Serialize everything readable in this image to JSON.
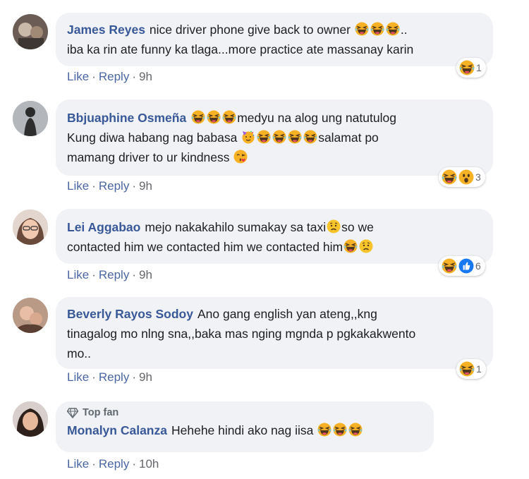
{
  "comments": [
    {
      "author": "James Reyes",
      "text_a": "nice driver phone give back to owner ",
      "text_b": "..",
      "text_c": "iba ka rin ate funny ka tlaga...more practice ate massanay karin",
      "actions": {
        "like": "Like",
        "reply": "Reply",
        "time": "9h"
      },
      "reaction_count": "1"
    },
    {
      "author": "Bbjuaphine Osmeña",
      "text_a": "medyu na alog ung natutulog",
      "text_b": "Kung diwa habang nag babasa ",
      "text_c": "salamat po",
      "text_d": "mamang driver to ur kindness ",
      "actions": {
        "like": "Like",
        "reply": "Reply",
        "time": "9h"
      },
      "reaction_count": "3"
    },
    {
      "author": "Lei Aggabao",
      "text_a": "mejo nakakahilo sumakay sa taxi",
      "text_b": "so we",
      "text_c": "contacted him we contacted him we contacted him",
      "actions": {
        "like": "Like",
        "reply": "Reply",
        "time": "9h"
      },
      "reaction_count": "6"
    },
    {
      "author": "Beverly Rayos Sodoy",
      "text_a": "Ano gang english yan ateng,,kng",
      "text_b": "tinagalog mo nlng sna,,baka mas nging mgnda p pgkakakwento",
      "text_c": "mo..",
      "actions": {
        "like": "Like",
        "reply": "Reply",
        "time": "9h"
      },
      "reaction_count": "1"
    },
    {
      "badge": "Top fan",
      "author": "Monalyn Calanza",
      "text_a": "Hehehe hindi ako nag iisa ",
      "actions": {
        "like": "Like",
        "reply": "Reply",
        "time": "10h"
      }
    }
  ],
  "colors": {
    "author": "#385898",
    "bubble": "#f0f2f5",
    "muted": "#65676b",
    "link": "#4b67a1"
  },
  "icons": [
    "laughing-emoji-icon",
    "party-emoji-icon",
    "kiss-emoji-icon",
    "sad-emoji-icon",
    "wow-emoji-icon",
    "like-reaction-icon",
    "diamond-icon"
  ]
}
